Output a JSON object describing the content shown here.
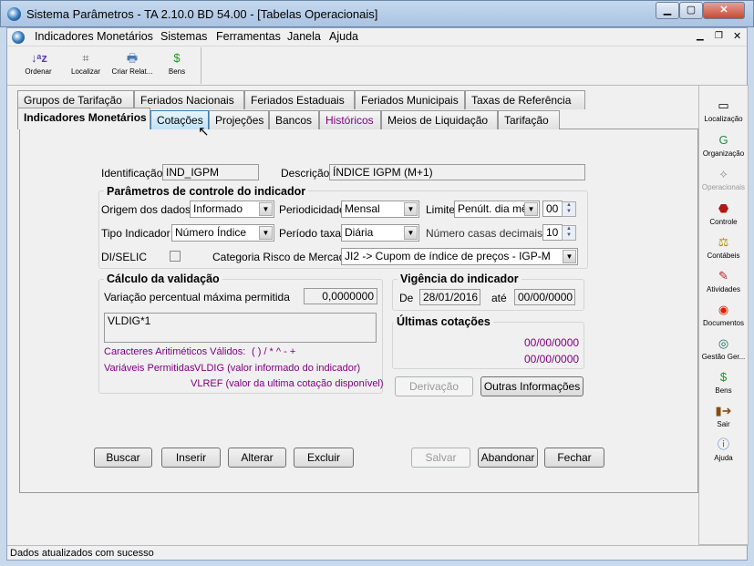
{
  "window": {
    "title": "Sistema Parâmetros -  TA 2.10.0 BD 54.00 - [Tabelas Operacionais]"
  },
  "menu": [
    "Indicadores Monetários",
    "Sistemas",
    "Ferramentas",
    "Janela",
    "Ajuda"
  ],
  "toolbar": [
    {
      "label": "Ordenar",
      "icon": "sort-az-icon"
    },
    {
      "label": "Localizar",
      "icon": "locate-icon"
    },
    {
      "label": "Criar Relat...",
      "icon": "printer-icon"
    },
    {
      "label": "Bens",
      "icon": "money-bag-icon"
    }
  ],
  "tabs_row1": [
    "Grupos de Tarifação",
    "Feriados Nacionais",
    "Feriados Estaduais",
    "Feriados Municipais",
    "Taxas de Referência"
  ],
  "tabs_row2": [
    "Indicadores Monetários",
    "Cotações",
    "Projeções",
    "Bancos",
    "Históricos",
    "Meios de Liquidação",
    "Tarifação"
  ],
  "form": {
    "identificacao_label": "Identificação",
    "identificacao": "IND_IGPM",
    "descricao_label": "Descrição",
    "descricao": "ÍNDICE IGPM (M+1)",
    "params_title": "Parâmetros de controle do indicador",
    "origem_label": "Origem dos dados",
    "origem": "Informado",
    "periodicidade_label": "Periodicidade",
    "periodicidade": "Mensal",
    "limite_label": "Limite",
    "limite": "Penúlt. dia mês",
    "limite_num": "00",
    "tipo_label": "Tipo Indicador",
    "tipo": "Número Índice",
    "periodo_label": "Período taxa",
    "periodo": "Diária",
    "casas_label": "Número casas decimais",
    "casas": "10",
    "diselic_label": "DI/SELIC",
    "categoria_label": "Categoria Risco de Mercado",
    "categoria": "JI2 -> Cupom de índice de preços - IGP-M",
    "calc_title": "Cálculo da validação",
    "variacao_label": "Variação percentual máxima permitida",
    "variacao": "0,0000000",
    "formula": "VLDIG*1",
    "caracteres_label": "Caracteres Aritiméticos Válidos:",
    "caracteres": "( ) / * ^ - +",
    "variaveis_label": "Variáveis Permitidas",
    "vldig": "VLDIG  (valor informado do indicador)",
    "vlref": "VLREF (valor da ultima cotação disponível)",
    "vigencia_title": "Vigência do indicador",
    "de_label": "De",
    "de": "28/01/2016",
    "ate_label": "até",
    "ate": "00/00/0000",
    "ultimas_title": "Últimas cotações",
    "ultima1": "00/00/0000",
    "ultima2": "00/00/0000",
    "derivacao": "Derivação",
    "outras": "Outras Informações"
  },
  "buttons": {
    "buscar": "Buscar",
    "inserir": "Inserir",
    "alterar": "Alterar",
    "excluir": "Excluir",
    "salvar": "Salvar",
    "abandonar": "Abandonar",
    "fechar": "Fechar"
  },
  "sidebar": [
    {
      "label": "Localização",
      "icon": "card-icon"
    },
    {
      "label": "Organização",
      "icon": "organization-icon"
    },
    {
      "label": "Operacionais",
      "icon": "handshake-icon",
      "disabled": true
    },
    {
      "label": "Controle",
      "icon": "stop-icon"
    },
    {
      "label": "Contábeis",
      "icon": "scales-icon"
    },
    {
      "label": "Atividades",
      "icon": "tool-icon"
    },
    {
      "label": "Documentos",
      "icon": "target-icon"
    },
    {
      "label": "Gestão Ger...",
      "icon": "eye-icon"
    },
    {
      "label": "Bens",
      "icon": "money-bag-icon"
    },
    {
      "label": "Sair",
      "icon": "exit-door-icon"
    },
    {
      "label": "Ajuda",
      "icon": "help-icon"
    }
  ],
  "status": "Dados atualizados com sucesso"
}
